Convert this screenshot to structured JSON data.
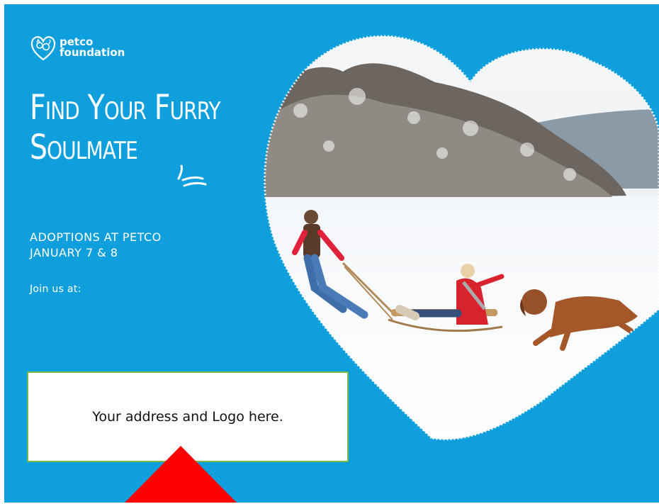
{
  "logo": {
    "line1": "petco",
    "line2": "foundation"
  },
  "headline": {
    "line1": "Find Your Furry",
    "line2": "Soulmate"
  },
  "adoptions": {
    "line1": "ADOPTIONS AT PETCO",
    "line2": "JANUARY 7 & 8"
  },
  "join_label": "Join us at:",
  "address_placeholder": "Your address and Logo here.",
  "colors": {
    "background": "#109fdd",
    "text": "#ffffff",
    "box_border": "#7ab648",
    "arrow": "#ff0000"
  },
  "icons": [
    "heart-pet-logo-icon",
    "swoosh-icon",
    "red-triangle-arrow-icon"
  ]
}
